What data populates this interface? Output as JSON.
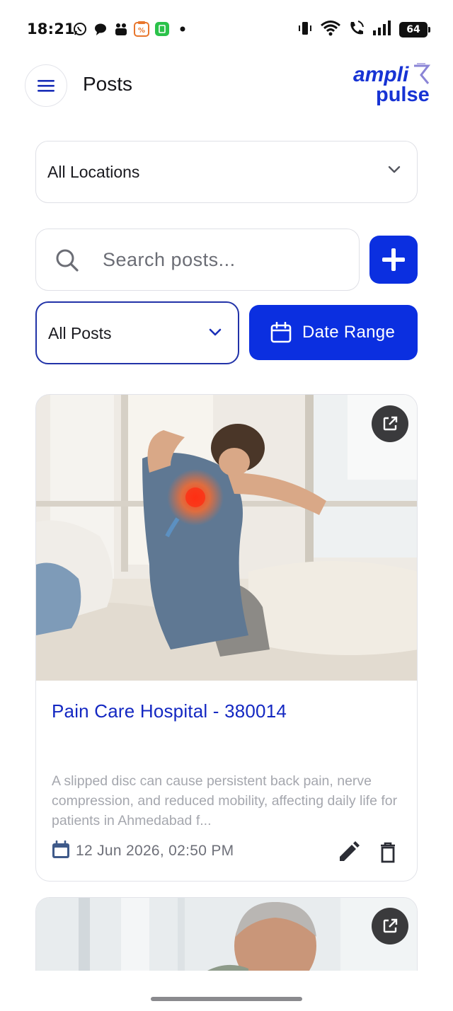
{
  "status_bar": {
    "time": "18:21",
    "battery": "64",
    "notification_icons": [
      "whatsapp-icon",
      "chat-icon",
      "app-icon",
      "offer-icon",
      "calculator-icon",
      "dot-icon"
    ],
    "system_icons": [
      "vibrate-icon",
      "wifi-icon",
      "wifi-call-icon",
      "signal-icon",
      "battery-icon"
    ]
  },
  "app_bar": {
    "title": "Posts",
    "logo_line1": "ampli",
    "logo_line2": "pulse"
  },
  "filters": {
    "location": "All Locations",
    "search_placeholder": "Search posts...",
    "post_type": "All Posts",
    "date_range_label": "Date Range"
  },
  "posts": [
    {
      "title": "Pain Care Hospital - 380014",
      "description": "A slipped disc can cause persistent back pain, nerve compression, and reduced mobility, affecting daily life for patients in Ahmedabad f...",
      "date": "12 Jun 2026, 02:50 PM"
    }
  ],
  "colors": {
    "primary": "#0b2fe0",
    "title_blue": "#1428c2",
    "border": "#dfe0e6",
    "muted_text": "#a5a7ae"
  }
}
